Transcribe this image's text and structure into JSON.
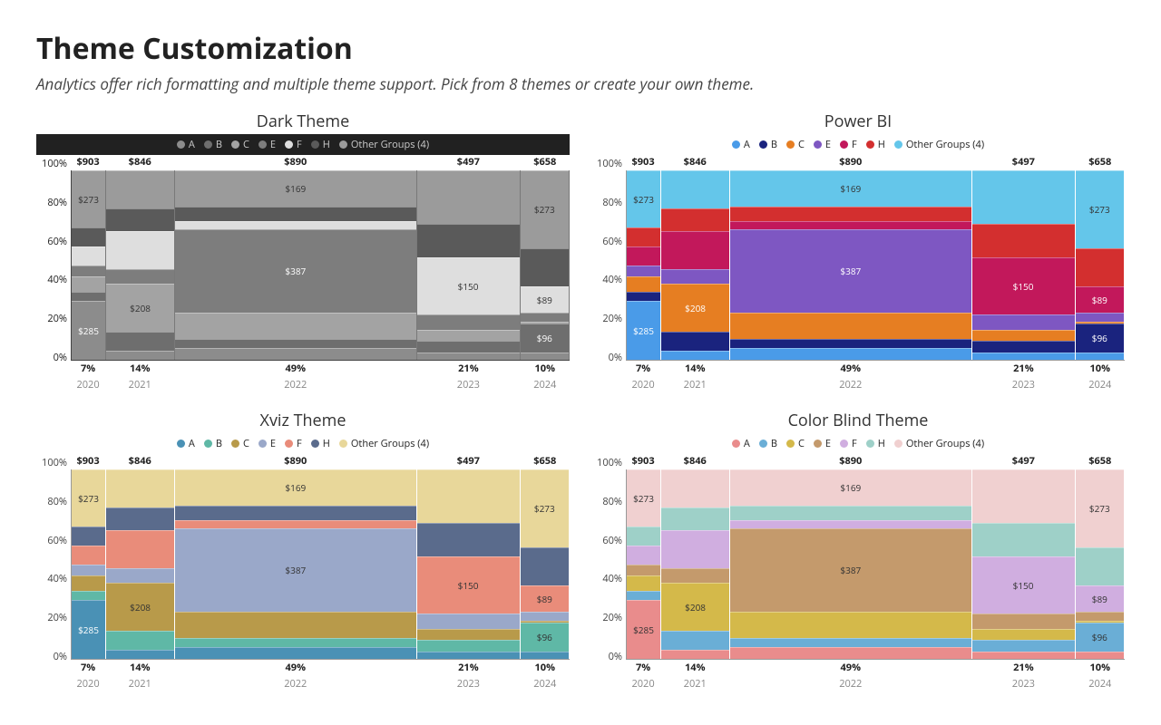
{
  "page_title": "Theme Customization",
  "subtitle": "Analytics offer rich formatting and multiple theme support. Pick from 8 themes or create your own theme.",
  "legend_series": [
    "A",
    "B",
    "C",
    "E",
    "F",
    "H",
    "Other Groups (4)"
  ],
  "yaxis_ticks": [
    "100%",
    "80%",
    "60%",
    "40%",
    "20%",
    "0%"
  ],
  "categories": [
    "2020",
    "2021",
    "2022",
    "2023",
    "2024"
  ],
  "col_top_totals": [
    "$903",
    "$846",
    "$890",
    "$497",
    "$658"
  ],
  "col_width_pct_labels": [
    "7%",
    "14%",
    "49%",
    "21%",
    "10%"
  ],
  "col_width_pct": [
    7,
    14,
    49,
    21,
    10
  ],
  "segment_labels": {
    "2020": {
      "A": "$285",
      "Other": "$273"
    },
    "2021": {
      "C": "$208"
    },
    "2022": {
      "E": "$387",
      "Other": "$169"
    },
    "2023": {
      "F": "$150"
    },
    "2024": {
      "B": "$96",
      "F": "$89",
      "Other": "$273"
    }
  },
  "chart_data": [
    {
      "name": "Dark Theme",
      "palette": [
        "#8c8c8c",
        "#6e6e6e",
        "#a3a3a3",
        "#7d7d7d",
        "#dedede",
        "#5a5a5a",
        "#9b9b9b"
      ]
    },
    {
      "name": "Power BI",
      "palette": [
        "#4a9be8",
        "#1a237e",
        "#e67e22",
        "#7e57c2",
        "#c2185b",
        "#d32f2f",
        "#64c6ea"
      ]
    },
    {
      "name": "Xviz Theme",
      "palette": [
        "#4a91b5",
        "#5fb8a6",
        "#b89a4a",
        "#9aa8c9",
        "#e98c7a",
        "#5a6b8c",
        "#e8d79a"
      ]
    },
    {
      "name": "Color Blind Theme",
      "palette": [
        "#e98c8c",
        "#6aaed6",
        "#d4b94a",
        "#c49a6c",
        "#d0aee0",
        "#9ed0c8",
        "#f0d0d0"
      ]
    }
  ],
  "series_heights_pct": {
    "2020": {
      "A": 31,
      "B": 5,
      "C": 8,
      "E": 6,
      "F": 10,
      "H": 10,
      "Other": 30
    },
    "2021": {
      "A": 5,
      "B": 10,
      "C": 25,
      "E": 8,
      "F": 20,
      "H": 12,
      "Other": 20
    },
    "2022": {
      "A": 6,
      "B": 5,
      "C": 14,
      "E": 44,
      "F": 4,
      "H": 8,
      "Other": 19
    },
    "2023": {
      "A": 4,
      "B": 6,
      "C": 6,
      "E": 8,
      "F": 30,
      "H": 18,
      "Other": 28
    },
    "2024": {
      "A": 4,
      "B": 15,
      "C": 1,
      "E": 5,
      "F": 14,
      "H": 20,
      "Other": 41
    }
  }
}
